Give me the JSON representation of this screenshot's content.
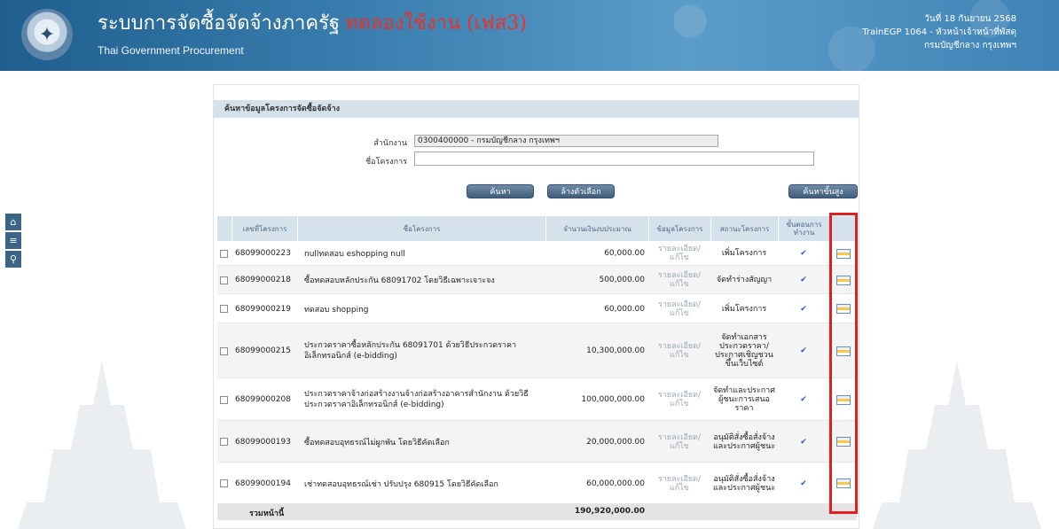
{
  "header": {
    "title": "ระบบการจัดซื้อจัดจ้างภาครัฐ",
    "demo_label": "ทดลองใช้งาน (เฟส3)",
    "subtitle": "Thai Government Procurement",
    "date": "วันที่ 18 กันยายน 2568",
    "user": "TrainEGP 1064 - หัวหน้าเจ้าหน้าที่พัสดุ",
    "department": "กรมบัญชีกลาง กรุงเทพฯ"
  },
  "side_tools": {
    "home_icon": "home-icon",
    "menu_icon": "menu-icon",
    "search_icon": "search-icon"
  },
  "panel": {
    "title": "ค้นหาข้อมูลโครงการจัดซื้อจัดจ้าง",
    "dept_label": "สำนักงาน",
    "dept_value": "0300400000 - กรมบัญชีกลาง กรุงเทพฯ",
    "project_label": "ชื่อโครงการ",
    "project_value": "",
    "search_button": "ค้นหา",
    "clear_button": "ล้างตัวเลือก",
    "advanced_button": "ค้นหาขั้นสูง"
  },
  "table": {
    "headers": {
      "project_no": "เลขที่โครงการ",
      "project_name": "ชื่อโครงการ",
      "budget": "จำนวนเงินงบประมาณ",
      "info": "ข้อมูลโครงการ",
      "status": "สถานะโครงการ",
      "step": "ขั้นตอนการทำงาน"
    },
    "rows": [
      {
        "no": "68099000223",
        "name": "nullทดสอบ eshopping null",
        "budget": "60,000.00",
        "info": "รายละเอียด/แก้ไข",
        "status": "เพิ่มโครงการ"
      },
      {
        "no": "68099000218",
        "name": "ซื้อทดสอบหลักประกัน 68091702 โดยวิธีเฉพาะเจาะจง",
        "budget": "500,000.00",
        "info": "รายละเอียด/แก้ไข",
        "status": "จัดทำร่างสัญญา"
      },
      {
        "no": "68099000219",
        "name": "ทดสอบ shopping",
        "budget": "60,000.00",
        "info": "รายละเอียด/แก้ไข",
        "status": "เพิ่มโครงการ"
      },
      {
        "no": "68099000215",
        "name": "ประกวดราคาซื้อหลักประกัน 68091701 ด้วยวิธีประกวดราคาอิเล็กทรอนิกส์ (e-bidding)",
        "budget": "10,300,000.00",
        "info": "รายละเอียด/แก้ไข",
        "status": "จัดทำเอกสารประกวดราคา/ประกาศเชิญชวนขึ้นเว็บไซต์"
      },
      {
        "no": "68099000208",
        "name": "ประกวดราคาจ้างก่อสร้างงานจ้างก่อสร้างอาคารสำนักงาน ด้วยวิธีประกวดราคาอิเล็กทรอนิกส์ (e-bidding)",
        "budget": "100,000,000.00",
        "info": "รายละเอียด/แก้ไข",
        "status": "จัดทำและประกาศ ผู้ชนะการเสนอราคา"
      },
      {
        "no": "68099000193",
        "name": "ซื้อทดสอบอุทธรณ์ไม่ผูกพัน โดยวิธีคัดเลือก",
        "budget": "20,000,000.00",
        "info": "รายละเอียด/แก้ไข",
        "status": "อนุมัติสั่งซื้อสั่งจ้างและประกาศผู้ชนะ"
      },
      {
        "no": "68099000194",
        "name": "เช่าทดสอบอุทธรณ์เช่า ปรับปรุง 680915 โดยวิธีคัดเลือก",
        "budget": "60,000,000.00",
        "info": "รายละเอียด/แก้ไข",
        "status": "อนุมัติสั่งซื้อสั่งจ้างและประกาศผู้ชนะ"
      }
    ],
    "footer_label": "รวมหน้านี้",
    "footer_total": "190,920,000.00"
  }
}
